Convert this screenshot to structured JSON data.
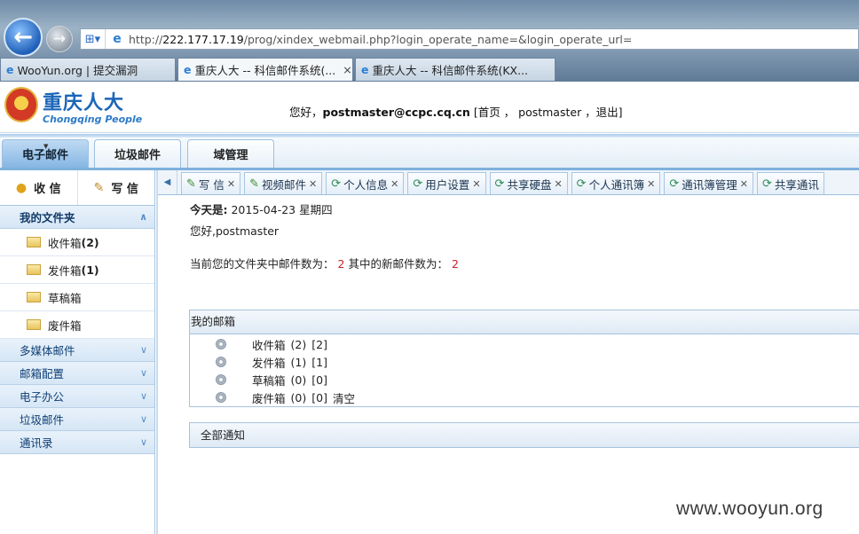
{
  "browser": {
    "url_prefix": "http://",
    "url_host": "222.177.17.19",
    "url_path": "/prog/xindex_webmail.php?login_operate_name=&login_operate_url=",
    "tabs": [
      {
        "label": "WooYun.org | 提交漏洞"
      },
      {
        "label": "重庆人大 -- 科信邮件系统(...",
        "close": "×"
      },
      {
        "label": "重庆人大 -- 科信邮件系统(KX..."
      }
    ]
  },
  "header": {
    "logo_cn": "重庆人大",
    "logo_en": "Chongqing People",
    "welcome_prefix": "您好，",
    "user": "postmaster@ccpc.cq.cn",
    "links": "[首页 ， postmaster ，退出]"
  },
  "main_tabs": [
    "电子邮件",
    "垃圾邮件",
    "域管理"
  ],
  "sidebar": {
    "receive": "收 信",
    "compose": "写 信",
    "sections": [
      {
        "label": "我的文件夹"
      },
      {
        "label": "多媒体邮件"
      },
      {
        "label": "邮箱配置"
      },
      {
        "label": "电子办公"
      },
      {
        "label": "垃圾邮件"
      },
      {
        "label": "通讯录"
      }
    ],
    "folders": [
      {
        "name": "收件箱",
        "count": "(2)"
      },
      {
        "name": "发件箱",
        "count": "(1)"
      },
      {
        "name": "草稿箱",
        "count": ""
      },
      {
        "name": "废件箱",
        "count": ""
      }
    ]
  },
  "tool_tabs": [
    "写 信",
    "视频邮件",
    "个人信息",
    "用户设置",
    "共享硬盘",
    "个人通讯簿",
    "通讯簿管理",
    "共享通讯"
  ],
  "content": {
    "today_label": "今天是:",
    "today_value": "2015-04-23 星期四",
    "greeting": "您好,postmaster",
    "count_label": "当前您的文件夹中邮件数为：",
    "count_value": "2",
    "new_label": "其中的新邮件数为：",
    "new_value": "2",
    "mybox_title": "我的邮箱",
    "mybox_rows": [
      {
        "name": "收件箱",
        "total": "(2)",
        "new": "[2]",
        "extra": ""
      },
      {
        "name": "发件箱",
        "total": "(1)",
        "new": "[1]",
        "extra": ""
      },
      {
        "name": "草稿箱",
        "total": "(0)",
        "new": "[0]",
        "extra": ""
      },
      {
        "name": "废件箱",
        "total": "(0)",
        "new": "[0]",
        "extra": "清空"
      }
    ],
    "notice_title": "全部通知"
  },
  "watermark": "www.wooyun.org"
}
